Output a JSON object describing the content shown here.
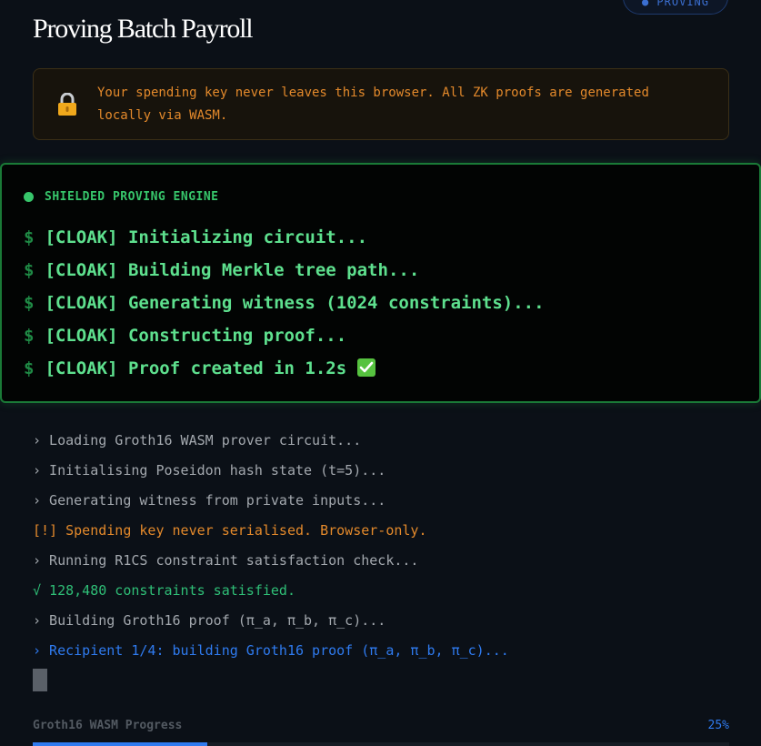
{
  "header": {
    "title": "Proving Batch Payroll",
    "status_pill": "● PROVING"
  },
  "notice": {
    "icon": "lock-icon",
    "text": "Your spending key never leaves this browser. All ZK proofs are generated locally via WASM."
  },
  "engine": {
    "title": "SHIELDED PROVING ENGINE",
    "prompt": "$",
    "lines": [
      "[CLOAK] Initializing circuit...",
      "[CLOAK] Building Merkle tree path...",
      "[CLOAK] Generating witness (1024 constraints)...",
      "[CLOAK] Constructing proof...",
      "[CLOAK] Proof created in 1.2s"
    ],
    "done_icon": "check-mark-icon"
  },
  "log": [
    {
      "text": "› Loading Groth16 WASM prover circuit...",
      "kind": "info"
    },
    {
      "text": "› Initialising Poseidon hash state (t=5)...",
      "kind": "info"
    },
    {
      "text": "› Generating witness from private inputs...",
      "kind": "info"
    },
    {
      "text": "[!] Spending key never serialised. Browser-only.",
      "kind": "warn"
    },
    {
      "text": "› Running R1CS constraint satisfaction check...",
      "kind": "info"
    },
    {
      "text": "√ 128,480 constraints satisfied.",
      "kind": "ok"
    },
    {
      "text": "› Building Groth16 proof (π_a, π_b, π_c)...",
      "kind": "info"
    },
    {
      "text": "› Recipient 1/4: building Groth16 proof (π_a, π_b, π_c)...",
      "kind": "active"
    }
  ],
  "progress": {
    "label": "Groth16 WASM Progress",
    "percent_label": "25%",
    "value": 25
  },
  "colors": {
    "accent_green": "#37c66b",
    "warning_orange": "#e3892b",
    "accent_blue": "#2f7bf0"
  }
}
